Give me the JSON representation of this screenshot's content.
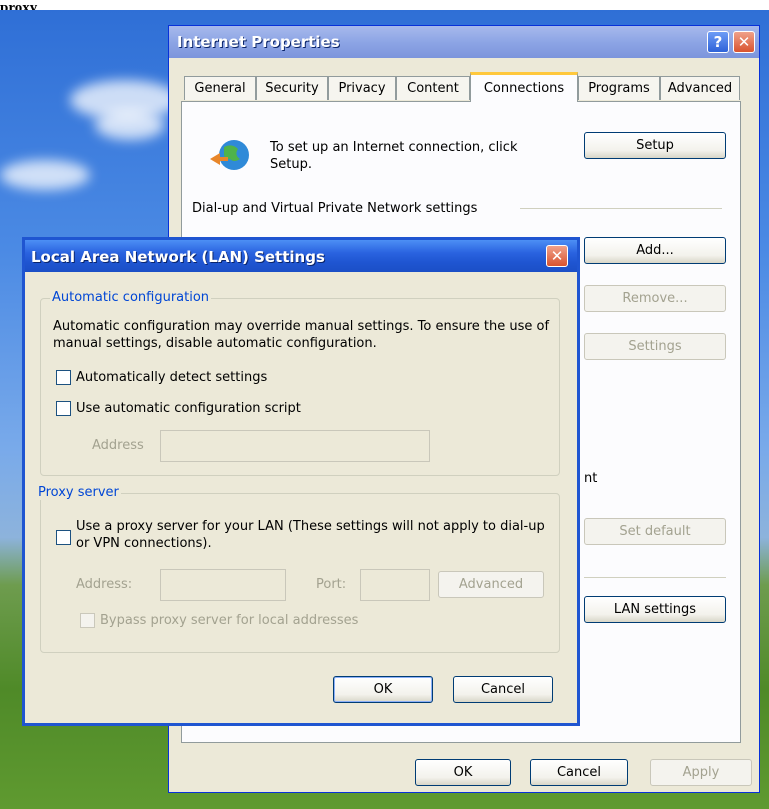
{
  "caption": "proxy",
  "internet_properties": {
    "title": "Internet Properties",
    "help_symbol": "?",
    "close_symbol": "✕",
    "tabs": [
      {
        "label": "General"
      },
      {
        "label": "Security"
      },
      {
        "label": "Privacy"
      },
      {
        "label": "Content"
      },
      {
        "label": "Connections"
      },
      {
        "label": "Programs"
      },
      {
        "label": "Advanced"
      }
    ],
    "setup_text": "To set up an Internet connection, click Setup.",
    "setup_button": "Setup",
    "dialup_heading": "Dial-up and Virtual Private Network settings",
    "add_button": "Add...",
    "remove_button": "Remove...",
    "settings_button": "Settings",
    "partial_text": "nt",
    "set_default_button": "Set default",
    "lan_settings_button": "LAN settings",
    "ok_button": "OK",
    "cancel_button": "Cancel",
    "apply_button": "Apply"
  },
  "lan_dialog": {
    "title": "Local Area Network (LAN) Settings",
    "close_symbol": "✕",
    "auto_config": {
      "label": "Automatic configuration",
      "description": "Automatic configuration may override manual settings.  To ensure the use of manual settings, disable automatic configuration.",
      "auto_detect_label": "Automatically detect settings",
      "auto_detect_checked": false,
      "use_script_label": "Use automatic configuration script",
      "use_script_checked": false,
      "address_label": "Address",
      "address_value": ""
    },
    "proxy": {
      "label": "Proxy server",
      "use_proxy_label": "Use a proxy server for your LAN (These settings will not apply to dial-up or VPN connections).",
      "use_proxy_checked": false,
      "address_label": "Address:",
      "address_value": "",
      "port_label": "Port:",
      "port_value": "",
      "advanced_button": "Advanced",
      "bypass_label": "Bypass proxy server for local addresses",
      "bypass_checked": false
    },
    "ok_button": "OK",
    "cancel_button": "Cancel"
  }
}
